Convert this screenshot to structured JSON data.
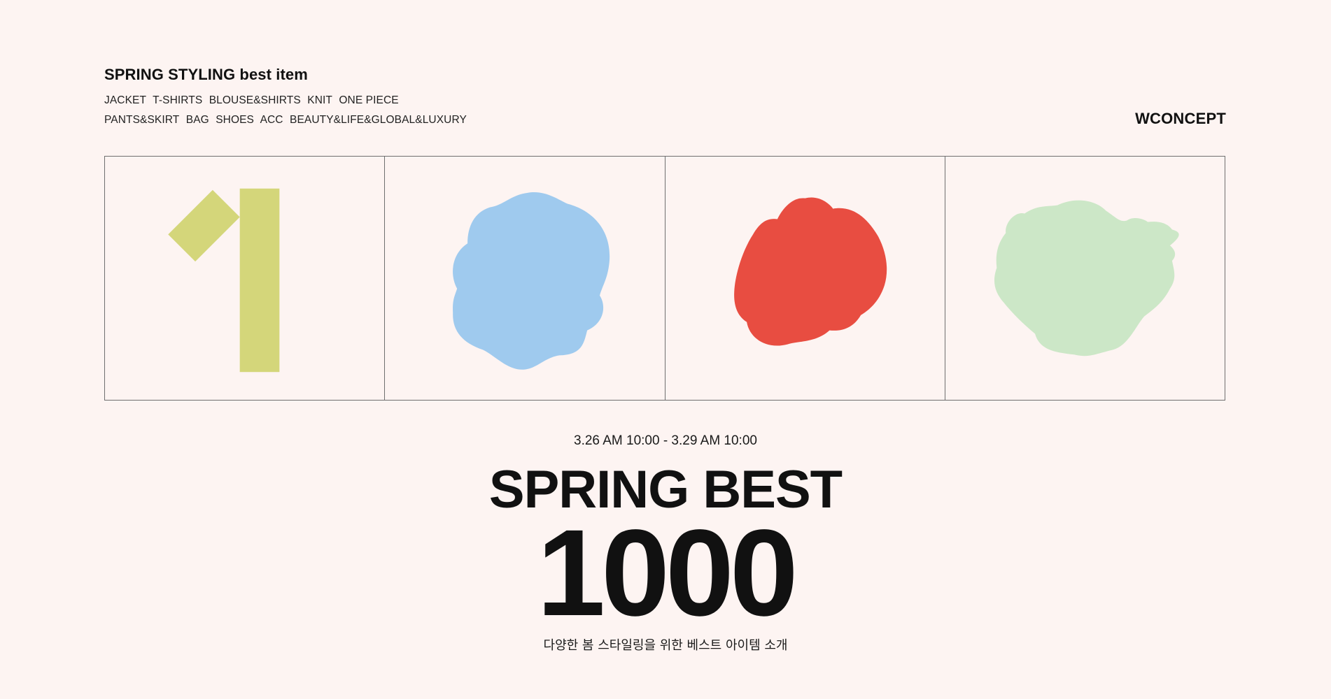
{
  "header": {
    "title": "SPRING STYLING best item",
    "categories_line1": [
      "JACKET",
      "T-SHIRTS",
      "BLOUSE&SHIRTS",
      "KNIT",
      "ONE PIECE"
    ],
    "categories_line2": [
      "PANTS&SKIRT",
      "BAG",
      "SHOES",
      "ACC",
      "BEAUTY&LIFE&GLOBAL&LUXURY"
    ],
    "brand": "WCONCEPT"
  },
  "panels": [
    {
      "shape": "digit-one",
      "color": "#d4d67a"
    },
    {
      "shape": "blob",
      "color": "#9fcaee"
    },
    {
      "shape": "blob",
      "color": "#e84d41"
    },
    {
      "shape": "blob",
      "color": "#cce7c7"
    }
  ],
  "event": {
    "date": "3.26 AM 10:00 - 3.29 AM 10:00",
    "title": "SPRING BEST",
    "number": "1000",
    "subtitle": "다양한 봄 스타일링을 위한 베스트 아이템 소개"
  }
}
